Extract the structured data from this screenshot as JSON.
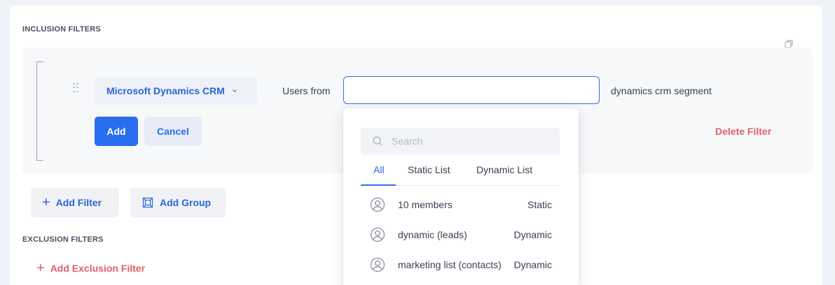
{
  "inclusion": {
    "title": "INCLUSION FILTERS",
    "source_label": "Microsoft Dynamics CRM",
    "users_from_label": "Users from",
    "segment_value": "",
    "segment_suffix": "dynamics crm segment",
    "add_label": "Add",
    "cancel_label": "Cancel",
    "delete_label": "Delete Filter",
    "add_filter_label": "Add Filter",
    "add_group_label": "Add Group"
  },
  "exclusion": {
    "title": "EXCLUSION FILTERS",
    "add_label": "Add Exclusion Filter"
  },
  "dropdown": {
    "search_placeholder": "Search",
    "tabs": [
      {
        "label": "All",
        "active": true
      },
      {
        "label": "Static List",
        "active": false
      },
      {
        "label": "Dynamic List",
        "active": false
      }
    ],
    "items": [
      {
        "name": "10 members",
        "type": "Static"
      },
      {
        "name": "dynamic (leads)",
        "type": "Dynamic"
      },
      {
        "name": "marketing list (contacts)",
        "type": "Dynamic"
      }
    ]
  },
  "colors": {
    "accent": "#2a6ef0",
    "danger": "#e0606a"
  },
  "icons": {
    "copy": "copy-icon",
    "drag": "drag-handle-icon",
    "chevron": "chevron-down-icon",
    "search": "search-icon",
    "person": "person-icon",
    "group": "group-icon",
    "plus": "plus-icon"
  }
}
